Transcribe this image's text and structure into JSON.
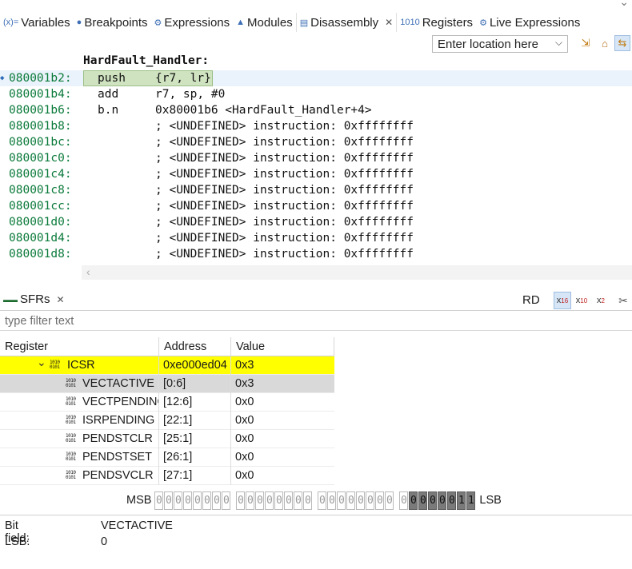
{
  "tabs": [
    {
      "icon": "(x)=",
      "label": "Variables"
    },
    {
      "icon": "●",
      "label": "Breakpoints"
    },
    {
      "icon": "⚙",
      "label": "Expressions"
    },
    {
      "icon": "▲",
      "label": "Modules"
    },
    {
      "icon": "▤",
      "label": "Disassembly",
      "active": true
    },
    {
      "icon": "1010",
      "label": "Registers"
    },
    {
      "icon": "⚙",
      "label": "Live Expressions"
    }
  ],
  "location": {
    "value": "Enter location here"
  },
  "disassembly": {
    "function_label": "HardFault_Handler:",
    "lines": [
      {
        "addr": "080001b2:",
        "mnemonic": "push",
        "operands": "{r7, lr}",
        "current": true
      },
      {
        "addr": "080001b4:",
        "mnemonic": "add",
        "operands": "r7, sp, #0"
      },
      {
        "addr": "080001b6:",
        "mnemonic": "b.n",
        "operands": "0x80001b6 <HardFault_Handler+4>"
      },
      {
        "addr": "080001b8:",
        "mnemonic": "",
        "operands": "; <UNDEFINED> instruction: 0xffffffff"
      },
      {
        "addr": "080001bc:",
        "mnemonic": "",
        "operands": "; <UNDEFINED> instruction: 0xffffffff"
      },
      {
        "addr": "080001c0:",
        "mnemonic": "",
        "operands": "; <UNDEFINED> instruction: 0xffffffff"
      },
      {
        "addr": "080001c4:",
        "mnemonic": "",
        "operands": "; <UNDEFINED> instruction: 0xffffffff"
      },
      {
        "addr": "080001c8:",
        "mnemonic": "",
        "operands": "; <UNDEFINED> instruction: 0xffffffff"
      },
      {
        "addr": "080001cc:",
        "mnemonic": "",
        "operands": "; <UNDEFINED> instruction: 0xffffffff"
      },
      {
        "addr": "080001d0:",
        "mnemonic": "",
        "operands": "; <UNDEFINED> instruction: 0xffffffff"
      },
      {
        "addr": "080001d4:",
        "mnemonic": "",
        "operands": "; <UNDEFINED> instruction: 0xffffffff"
      },
      {
        "addr": "080001d8:",
        "mnemonic": "",
        "operands": "; <UNDEFINED> instruction: 0xffffffff"
      }
    ]
  },
  "sfr": {
    "tab_label": "SFRs",
    "rd_label": "RD",
    "radix": [
      {
        "base": "x",
        "sub": "16",
        "on": true
      },
      {
        "base": "x",
        "sub": "10",
        "on": false
      },
      {
        "base": "x",
        "sub": "2",
        "on": false
      }
    ],
    "filter_placeholder": "type filter text",
    "columns": [
      "Register",
      "Address",
      "Value"
    ],
    "rows": [
      {
        "name": "ICSR",
        "address": "0xe000ed04",
        "value": "0x3",
        "level": 0,
        "style": "yellow"
      },
      {
        "name": "VECTACTIVE",
        "address": "[0:6]",
        "value": "0x3",
        "level": 1,
        "style": "grey"
      },
      {
        "name": "VECTPENDING",
        "address": "[12:6]",
        "value": "0x0",
        "level": 1,
        "style": ""
      },
      {
        "name": "ISRPENDING",
        "address": "[22:1]",
        "value": "0x0",
        "level": 1,
        "style": ""
      },
      {
        "name": "PENDSTCLR",
        "address": "[25:1]",
        "value": "0x0",
        "level": 1,
        "style": ""
      },
      {
        "name": "PENDSTSET",
        "address": "[26:1]",
        "value": "0x0",
        "level": 1,
        "style": ""
      },
      {
        "name": "PENDSVCLR",
        "address": "[27:1]",
        "value": "0x0",
        "level": 1,
        "style": ""
      }
    ],
    "bits": {
      "msb_label": "MSB",
      "lsb_label": "LSB",
      "values": "00000000000000000000000000000011",
      "selected_count": 7
    },
    "info": [
      {
        "key": "Bit field:",
        "value": "VECTACTIVE"
      },
      {
        "key": "LSB:",
        "value": "0"
      }
    ]
  }
}
